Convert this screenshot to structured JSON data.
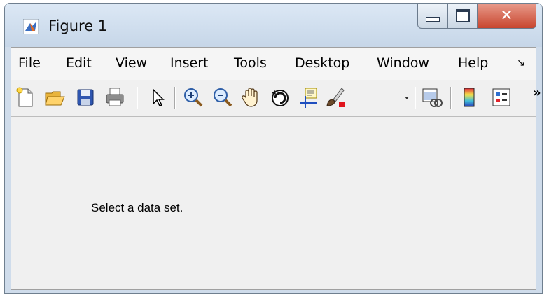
{
  "window": {
    "title": "Figure 1"
  },
  "menubar": {
    "items": [
      "File",
      "Edit",
      "View",
      "Insert",
      "Tools",
      "Desktop",
      "Window",
      "Help"
    ],
    "overflow_icon": "dock-arrow-icon"
  },
  "toolbar": {
    "icons": [
      "new-figure-icon",
      "open-file-icon",
      "save-icon",
      "print-icon",
      "edit-plot-icon",
      "zoom-in-icon",
      "zoom-out-icon",
      "pan-icon",
      "rotate-3d-icon",
      "data-cursor-icon",
      "brush-icon",
      "link-plot-icon",
      "colorbar-icon",
      "legend-icon"
    ],
    "overflow": "»"
  },
  "content": {
    "message": "Select a data set."
  }
}
